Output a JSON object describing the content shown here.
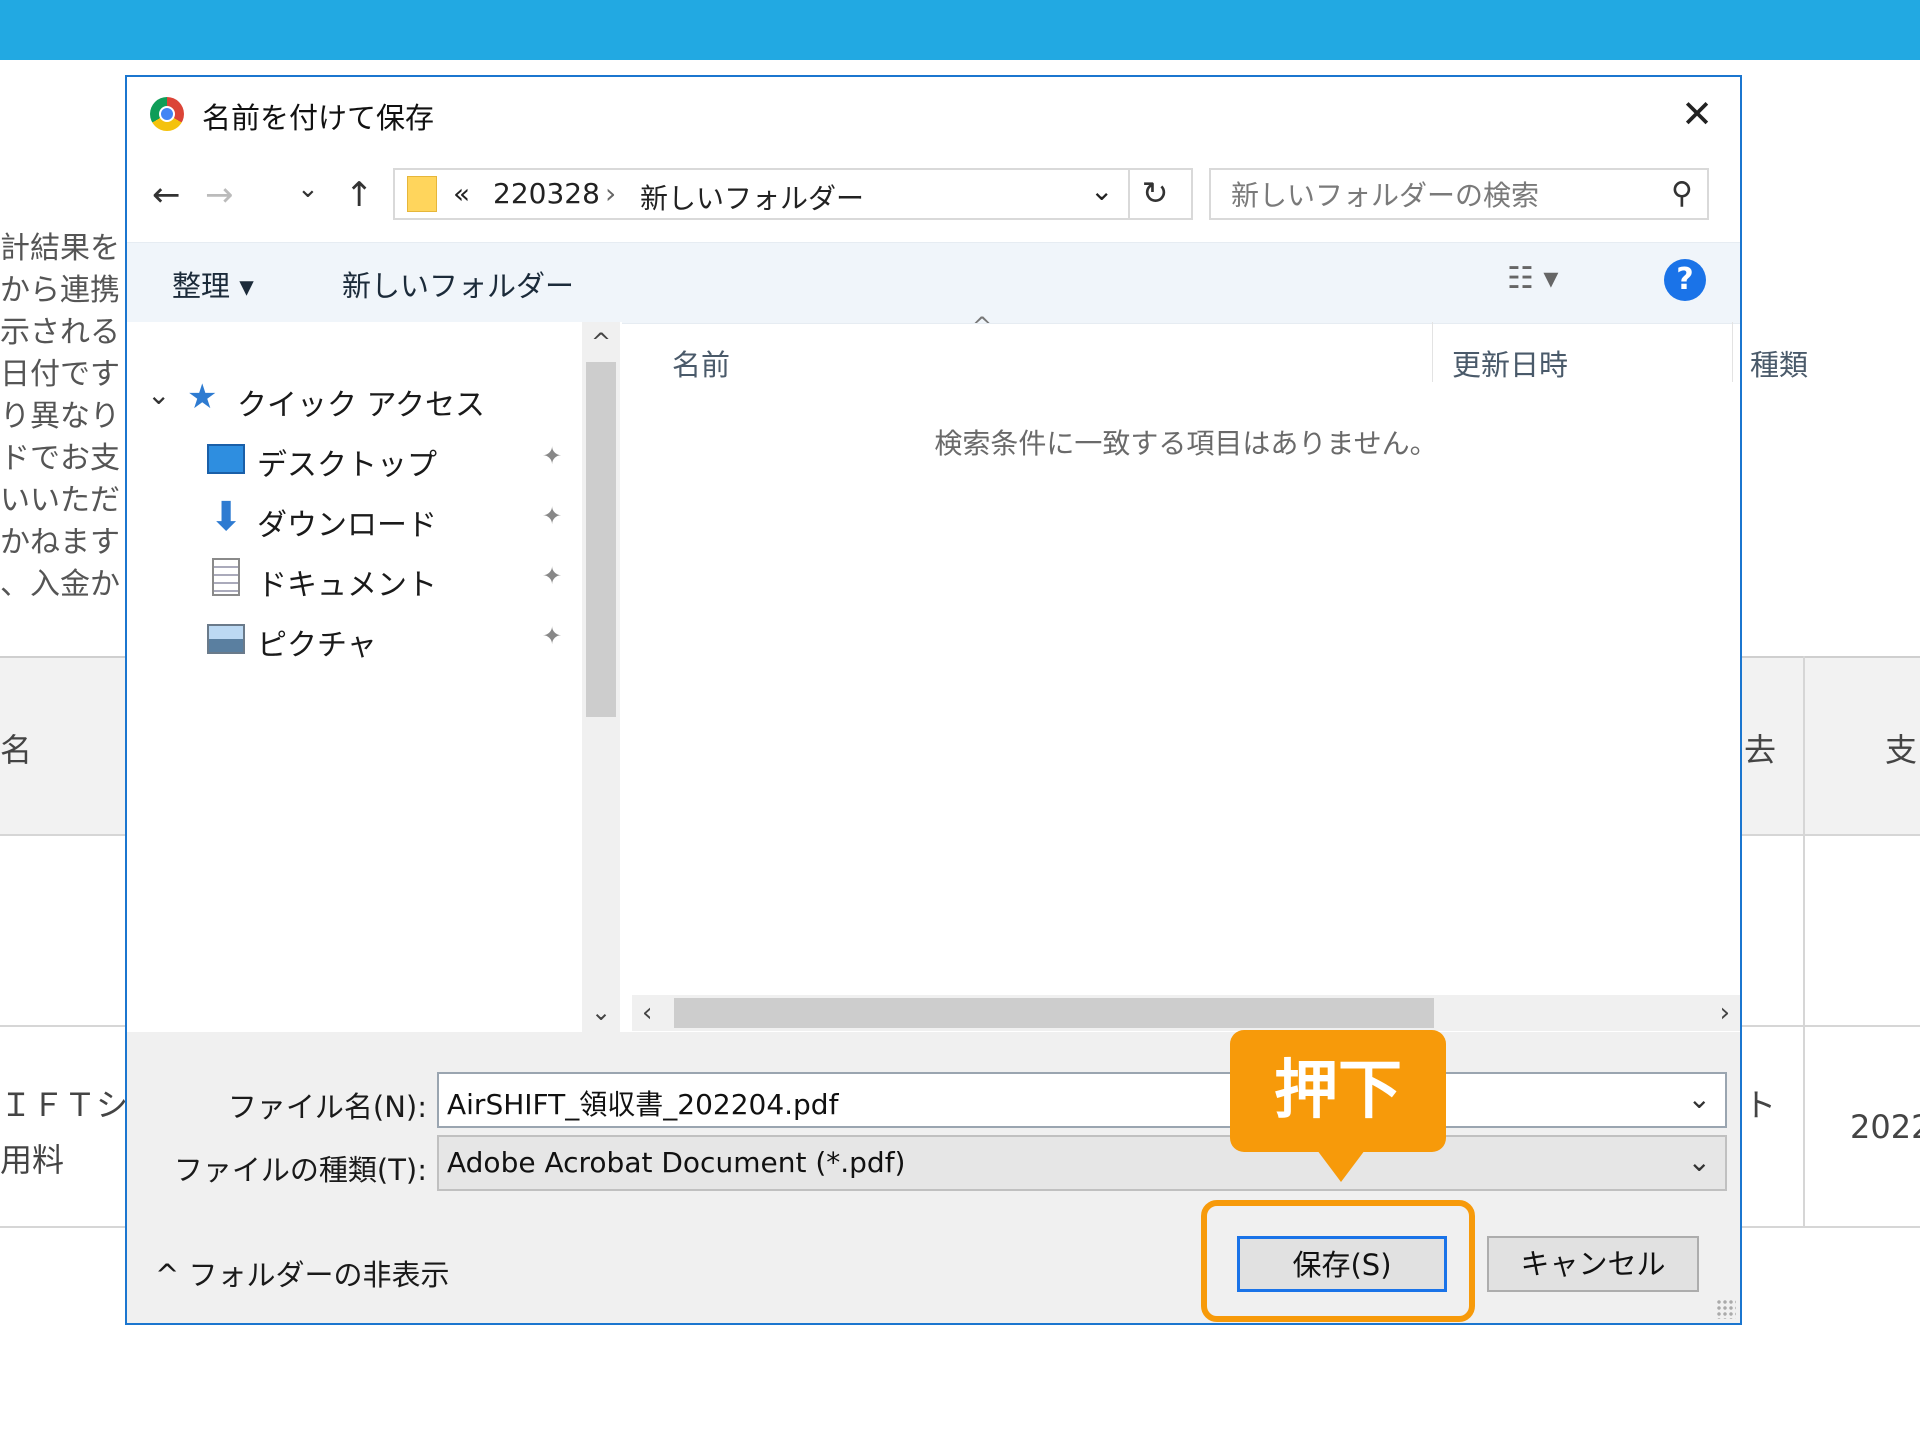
{
  "background_page": {
    "left_text_lines": [
      "計結果を",
      "から連携",
      "示される",
      "日付です",
      "り異なり",
      "ドでお支",
      "いいただ",
      "かねます",
      "、入金か"
    ],
    "table_header_left": "名",
    "table_header_right_1": "去",
    "table_header_right_2": "支",
    "table_row_left_1": "ＩＦＴシ",
    "table_row_left_2": "用料",
    "table_row_right_1": "ト",
    "table_row_right_2": "2022"
  },
  "dialog": {
    "title": "名前を付けて保存",
    "close_glyph": "✕",
    "nav": {
      "back_glyph": "←",
      "forward_glyph": "→",
      "recent_glyph": "⌄",
      "up_glyph": "↑",
      "address_prefix": "«",
      "address_path": [
        "220328",
        "新しいフォルダー"
      ],
      "address_sep": "›",
      "address_dropdown_glyph": "⌄",
      "refresh_glyph": "↻",
      "search_placeholder": "新しいフォルダーの検索",
      "search_glyph": "⚲"
    },
    "toolbar": {
      "organize_label": "整理 ▾",
      "new_folder_label": "新しいフォルダー",
      "view_glyph": "☷ ▾",
      "help_glyph": "?"
    },
    "nav_pane": {
      "quick_access_label": "クイック アクセス",
      "items": [
        {
          "label": "デスクトップ",
          "icon": "desktop-icon"
        },
        {
          "label": "ダウンロード",
          "icon": "download-icon"
        },
        {
          "label": "ドキュメント",
          "icon": "document-icon"
        },
        {
          "label": "ピクチャ",
          "icon": "pictures-icon"
        }
      ],
      "pin_glyph": "📌"
    },
    "file_list": {
      "columns": [
        "名前",
        "更新日時",
        "種類"
      ],
      "sort_glyph": "^",
      "empty_message": "検索条件に一致する項目はありません。"
    },
    "form": {
      "filename_label": "ファイル名(N):",
      "filename_value": "AirSHIFT_領収書_202204.pdf",
      "filetype_label": "ファイルの種類(T):",
      "filetype_value": "Adobe Acrobat Document (*.pdf)",
      "dropdown_glyph": "⌄"
    },
    "footer": {
      "hide_folders_label": "^  フォルダーの非表示",
      "save_label": "保存(S)",
      "cancel_label": "キャンセル"
    }
  },
  "annotation": {
    "callout_text": "押下",
    "color": "#f79a0a"
  },
  "colors": {
    "topbar": "#22a9e2",
    "dialog_border": "#1b76cf",
    "save_border": "#1a73e8"
  }
}
